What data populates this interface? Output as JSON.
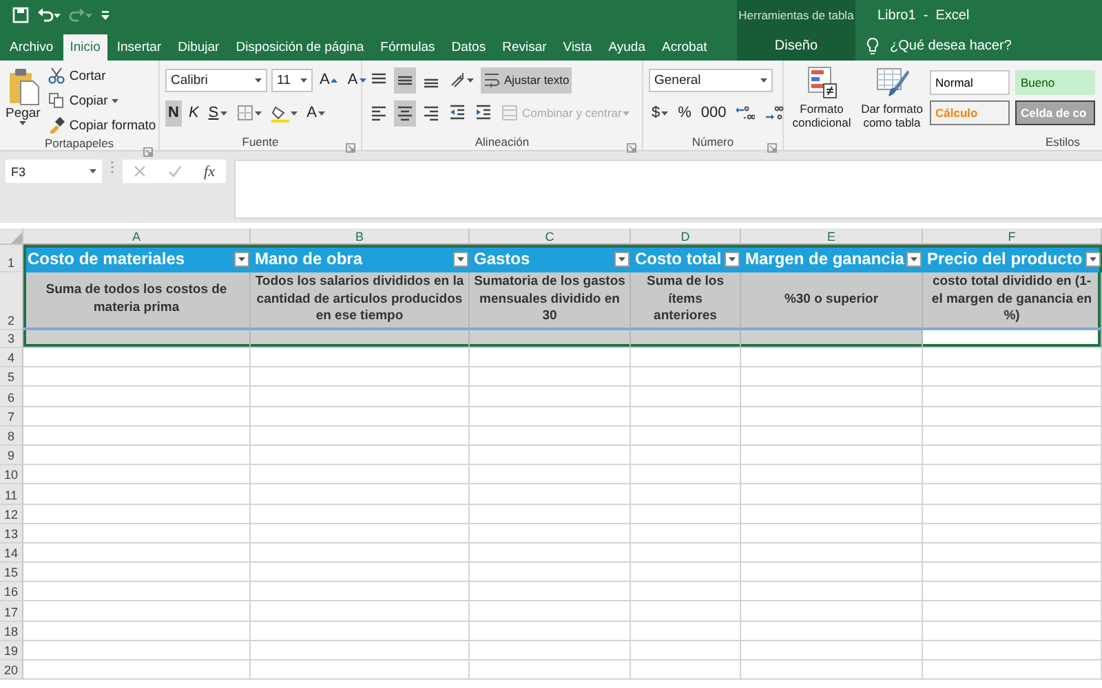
{
  "quick_access": [
    {
      "kind": "save",
      "disabled": false
    },
    {
      "kind": "undo",
      "disabled": false
    },
    {
      "kind": "redo",
      "disabled": true
    },
    {
      "kind": "customize",
      "disabled": false
    }
  ],
  "title_bar": {
    "context_group": "Herramientas de tabla",
    "title": "Libro1  -  Excel"
  },
  "tabs": [
    {
      "label": "Archivo",
      "selected": false,
      "kind": "normal"
    },
    {
      "label": "Inicio",
      "selected": true,
      "kind": "normal"
    },
    {
      "label": "Insertar",
      "selected": false,
      "kind": "normal"
    },
    {
      "label": "Dibujar",
      "selected": false,
      "kind": "normal"
    },
    {
      "label": "Disposición de página",
      "selected": false,
      "kind": "normal"
    },
    {
      "label": "Fórmulas",
      "selected": false,
      "kind": "normal"
    },
    {
      "label": "Datos",
      "selected": false,
      "kind": "normal"
    },
    {
      "label": "Revisar",
      "selected": false,
      "kind": "normal"
    },
    {
      "label": "Vista",
      "selected": false,
      "kind": "normal"
    },
    {
      "label": "Ayuda",
      "selected": false,
      "kind": "normal"
    },
    {
      "label": "Acrobat",
      "selected": false,
      "kind": "normal"
    },
    {
      "label": "Diseño",
      "selected": false,
      "kind": "contextual"
    }
  ],
  "tell_me": {
    "placeholder": "¿Qué desea hacer?"
  },
  "ribbon": {
    "clipboard": {
      "label": "Portapapeles",
      "launcher": true,
      "paste": "Pegar",
      "actions": [
        {
          "kind": "cut",
          "label": "Cortar",
          "dropdown": false
        },
        {
          "kind": "copy",
          "label": "Copiar",
          "dropdown": true
        },
        {
          "kind": "painter",
          "label": "Copiar formato",
          "dropdown": false
        }
      ]
    },
    "font": {
      "label": "Fuente",
      "launcher": true,
      "font_name": "Calibri",
      "font_size": "11",
      "row1": [
        {
          "kind": "grow",
          "label": "A"
        },
        {
          "kind": "shrink",
          "label": "A"
        }
      ],
      "row2": [
        {
          "kind": "bold",
          "label": "N",
          "selected": true,
          "dropdown": false
        },
        {
          "kind": "italic",
          "label": "K",
          "selected": false,
          "dropdown": false
        },
        {
          "kind": "underline",
          "label": "S",
          "selected": false,
          "dropdown": true
        },
        {
          "kind": "borders",
          "selected": false,
          "dropdown": true
        },
        {
          "kind": "fill",
          "selected": false,
          "dropdown": true
        },
        {
          "kind": "font-color",
          "label": "A",
          "selected": false,
          "dropdown": true
        }
      ]
    },
    "alignment": {
      "label": "Alineación",
      "launcher": true,
      "row1": [
        {
          "kind": "align-top",
          "selected": false,
          "dropdown": false
        },
        {
          "kind": "align-middle",
          "selected": true,
          "dropdown": false
        },
        {
          "kind": "align-bottom",
          "selected": false,
          "dropdown": false
        },
        {
          "kind": "orientation",
          "selected": false,
          "dropdown": true
        },
        {
          "kind": "wrap",
          "label": "Ajustar texto",
          "selected": true,
          "dropdown": false
        }
      ],
      "row2": [
        {
          "kind": "align-left",
          "selected": false,
          "dropdown": false
        },
        {
          "kind": "align-center",
          "selected": true,
          "dropdown": false
        },
        {
          "kind": "align-right",
          "selected": false,
          "dropdown": false
        },
        {
          "kind": "indent-less",
          "selected": false,
          "dropdown": false
        },
        {
          "kind": "indent-more",
          "selected": false,
          "dropdown": false
        },
        {
          "kind": "merge",
          "label": "Combinar y centrar",
          "selected": false,
          "disabled": true,
          "dropdown": true
        }
      ]
    },
    "number": {
      "label": "Número",
      "launcher": true,
      "format": "General",
      "row2": [
        {
          "kind": "currency",
          "label": "$",
          "dropdown": true
        },
        {
          "kind": "percent",
          "label": "%",
          "dropdown": false
        },
        {
          "kind": "thousands",
          "label": "000",
          "dropdown": false
        },
        {
          "kind": "dec-more",
          "dropdown": false
        },
        {
          "kind": "dec-less",
          "dropdown": false
        }
      ]
    },
    "styles": {
      "label": "Estilos",
      "buttons": [
        {
          "kind": "conditional",
          "label": "Formato condicional"
        },
        {
          "kind": "table",
          "label": "Dar formato como tabla"
        }
      ],
      "cell_styles": [
        {
          "kind": "normal",
          "label": "Normal"
        },
        {
          "kind": "good",
          "label": "Bueno"
        },
        {
          "kind": "calc",
          "label": "Cálculo"
        },
        {
          "kind": "check",
          "label": "Celda de co"
        }
      ]
    }
  },
  "formula_bar": {
    "name_box": "F3",
    "function_label": "fx"
  },
  "sheet": {
    "columns": [
      "A",
      "B",
      "C",
      "D",
      "E",
      "F"
    ],
    "row_numbers": [
      "1",
      "2",
      "3",
      "4",
      "5",
      "6",
      "7",
      "8",
      "9",
      "10",
      "11",
      "12",
      "13",
      "14",
      "15",
      "16",
      "17",
      "18",
      "19",
      "20"
    ],
    "table": {
      "headers": [
        "Costo de materiales",
        "Mano de obra",
        "Gastos",
        "Costo total",
        "Margen de ganancia",
        "Precio del producto"
      ],
      "descriptions": [
        "Suma de todos los costos de materia prima",
        "Todos los salarios divididos en la cantidad de articulos producidos en ese tiempo",
        "Sumatoria de los gastos mensuales dividido en 30",
        "Suma de los ítems anteriores",
        "%30 o superior",
        "costo total dividido en (1- el margen de ganancia en %)"
      ],
      "blank_row": [
        {
          "selected": false
        },
        {
          "selected": false
        },
        {
          "selected": false
        },
        {
          "selected": false
        },
        {
          "selected": false
        },
        {
          "selected": true
        }
      ]
    }
  }
}
